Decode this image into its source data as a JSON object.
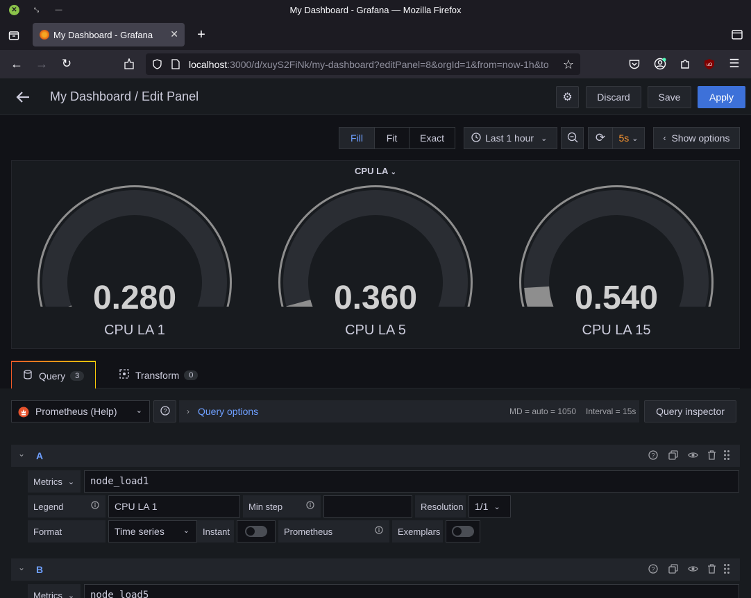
{
  "browser": {
    "window_title": "My Dashboard - Grafana — Mozilla Firefox",
    "tab_title": "My Dashboard - Grafana",
    "url_host": "localhost",
    "url_rest": ":3000/d/xuyS2FiNk/my-dashboard?editPanel=8&orgId=1&from=now-1h&to"
  },
  "header": {
    "title": "My Dashboard / Edit Panel",
    "discard": "Discard",
    "save": "Save",
    "apply": "Apply"
  },
  "toolbar": {
    "fill": "Fill",
    "fit": "Fit",
    "exact": "Exact",
    "time_range": "Last 1 hour",
    "refresh_interval": "5s",
    "show_options": "Show options"
  },
  "panel": {
    "title": "CPU LA",
    "gauges": [
      {
        "value": "0.280",
        "label": "CPU LA 1",
        "fraction": 0.07
      },
      {
        "value": "0.360",
        "label": "CPU LA 5",
        "fraction": 0.09
      },
      {
        "value": "0.540",
        "label": "CPU LA 15",
        "fraction": 0.135
      }
    ]
  },
  "tabs": {
    "query": {
      "label": "Query",
      "count": "3"
    },
    "transform": {
      "label": "Transform",
      "count": "0"
    }
  },
  "datasource": {
    "name": "Prometheus (Help)",
    "query_options": "Query options",
    "md": "MD = auto = 1050",
    "interval": "Interval = 15s",
    "inspector": "Query inspector"
  },
  "queries": [
    {
      "ref": "A",
      "metrics_label": "Metrics",
      "expr": "node_load1",
      "legend_label": "Legend",
      "legend": "CPU LA 1",
      "min_step_label": "Min step",
      "min_step": "",
      "resolution_label": "Resolution",
      "resolution": "1/1",
      "format_label": "Format",
      "format": "Time series",
      "instant_label": "Instant",
      "prometheus_label": "Prometheus",
      "exemplars_label": "Exemplars"
    },
    {
      "ref": "B",
      "metrics_label": "Metrics",
      "expr": "node_load5"
    }
  ],
  "colors": {
    "primary": "#3d71d9",
    "link": "#6e9fff",
    "refresh": "#ff9830",
    "gauge": "#8e8e8e"
  }
}
